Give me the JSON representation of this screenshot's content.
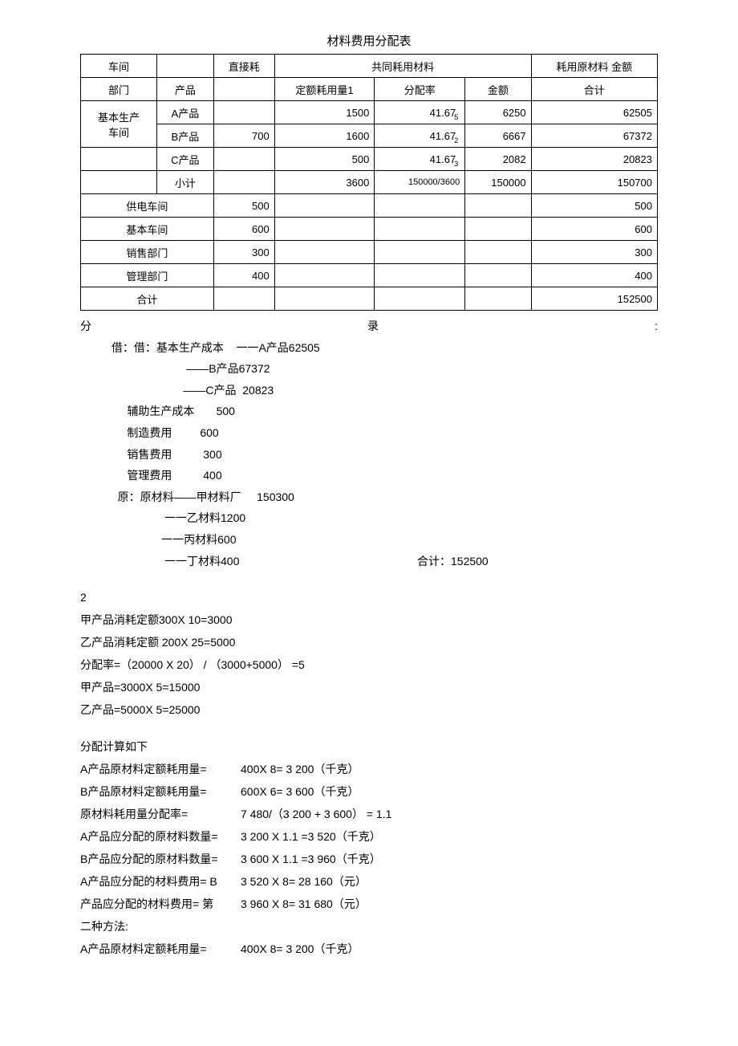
{
  "title": "材料费用分配表",
  "headers": {
    "workshop": "车间",
    "department": "部门",
    "product": "产品",
    "direct": "直接耗",
    "common": "共同耗用材料",
    "quota": "定额耗用量1",
    "rate": "分配率",
    "amount": "金额",
    "total_header": "耗用原材料 金额",
    "total_sub": "合计"
  },
  "rows": {
    "basic_shop": "基本生产",
    "basic_shop2": "车间",
    "a": {
      "name": "A产品",
      "direct": "",
      "quota": "1500",
      "rate": "41.67",
      "sub": "5",
      "amount": "6250",
      "total": "62505"
    },
    "b": {
      "name": "B产品",
      "direct": "700",
      "quota": "1600",
      "rate": "41.67",
      "sub": "2",
      "amount": "6667",
      "total": "67372"
    },
    "c": {
      "name": "C产品",
      "direct": "",
      "quota": "500",
      "rate": "41.67",
      "sub": "3",
      "amount": "2082",
      "total": "20823"
    },
    "subtotal": {
      "name": "小计",
      "direct": "",
      "quota": "3600",
      "rate": "150000/3600",
      "amount": "150000",
      "total": "150700"
    },
    "power": {
      "name": "供电车间",
      "direct": "500",
      "total": "500"
    },
    "base": {
      "name": "基本车间",
      "direct": "600",
      "total": "600"
    },
    "sales": {
      "name": "销售部门",
      "direct": "300",
      "total": "300"
    },
    "mgmt": {
      "name": "管理部门",
      "direct": "400",
      "total": "400"
    },
    "grand": {
      "name": "合计",
      "total": "152500"
    }
  },
  "journal": {
    "header_left": "分",
    "header_mid": "录",
    "header_right": ":",
    "l1": "          借：借：基本生产成本    一一A产品62505",
    "l2": "                                  ——B产品67372",
    "l3": "                                 ——C产品  20823",
    "l4": "               辅助生产成本       500",
    "l5": "               制造费用         600",
    "l6": "               销售费用          300",
    "l7": "               管理费用          400",
    "l8": "            原：原材料——甲材料厂     150300",
    "l9": "                           一一乙材料1200",
    "l10": "                          一一丙材料600",
    "l11a": "                           一一丁材料400",
    "l11b": "合计：152500"
  },
  "sec2": {
    "title": "2",
    "l1": "甲产品消耗定额300X 10=3000",
    "l2": "乙产品消耗定额 200X 25=5000",
    "l3": "分配率=（20000 X 20） /   （3000+5000） =5",
    "l4": "甲产品=3000X 5=15000",
    "l5": "乙产品=5000X 5=25000"
  },
  "sec3": {
    "title": "分配计算如下",
    "r1": {
      "k": "A产品原材料定额耗用量=",
      "v": "400X 8= 3 200（千克）"
    },
    "r2": {
      "k": " B产品原材料定额耗用量=",
      "v": "600X 6= 3 600（千克）"
    },
    "r3": {
      "k": "     原材料耗用量分配率=",
      "v": "7 480/（3 200 + 3 600） = 1.1"
    },
    "r4": {
      "k": "A产品应分配的原材料数量=",
      "v": "  3 200 X 1.1 =3 520（千克）"
    },
    "r5": {
      "k": "B产品应分配的原材料数量=",
      "v": "  3 600 X 1.1 =3 960（千克）"
    },
    "r6": {
      "k": "A产品应分配的材料费用= B",
      "v": "3 520 X 8= 28 160（元）"
    },
    "r7": {
      "k": "产品应分配的材料费用=  第",
      "v": "3 960 X 8= 31 680（元）"
    },
    "r8": {
      "k": "二种方法:",
      "v": ""
    },
    "r9": {
      "k": "A产品原材料定额耗用量=",
      "v": "400X 8= 3 200（千克）"
    }
  }
}
